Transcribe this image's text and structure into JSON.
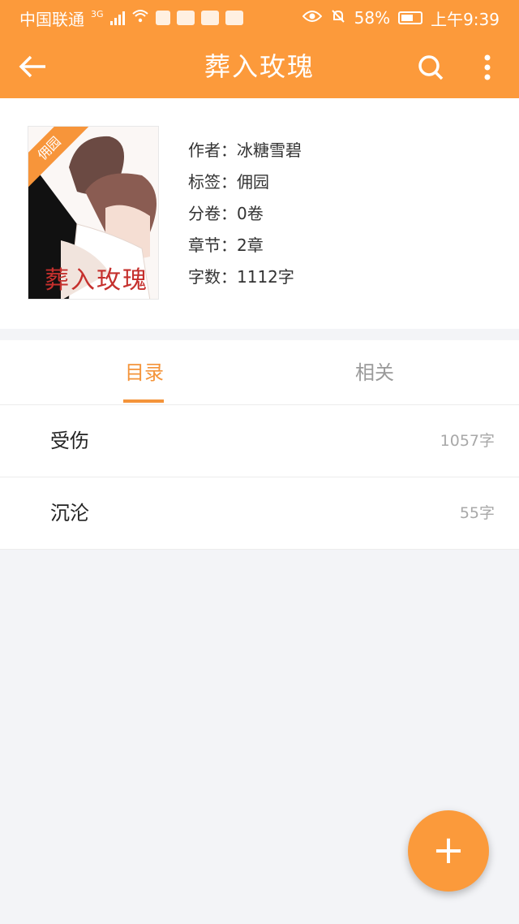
{
  "status_bar": {
    "carrier": "中国联通",
    "network": "3G",
    "battery": "58%",
    "time": "上午9:39"
  },
  "app_bar": {
    "title": "葬入玫瑰",
    "back_icon": "arrow-left-icon",
    "search_icon": "search-icon",
    "more_icon": "more-vertical-icon"
  },
  "book": {
    "cover_title": "葬入玫瑰",
    "cover_ribbon": "佣园",
    "author": "作者：冰糖雪碧",
    "tag": "标签：佣园",
    "volumes": "分卷：0卷",
    "chapters": "章节：2章",
    "words": "字数：1112字"
  },
  "tabs": [
    {
      "label": "目录",
      "active": true
    },
    {
      "label": "相关",
      "active": false
    }
  ],
  "chapter_list": [
    {
      "title": "受伤",
      "count": "1057字"
    },
    {
      "title": "沉沦",
      "count": "55字"
    }
  ],
  "fab": {
    "label": "+"
  },
  "colors": {
    "accent": "#fc9a3b",
    "tab_active": "#f4943a",
    "background": "#f3f4f7"
  }
}
